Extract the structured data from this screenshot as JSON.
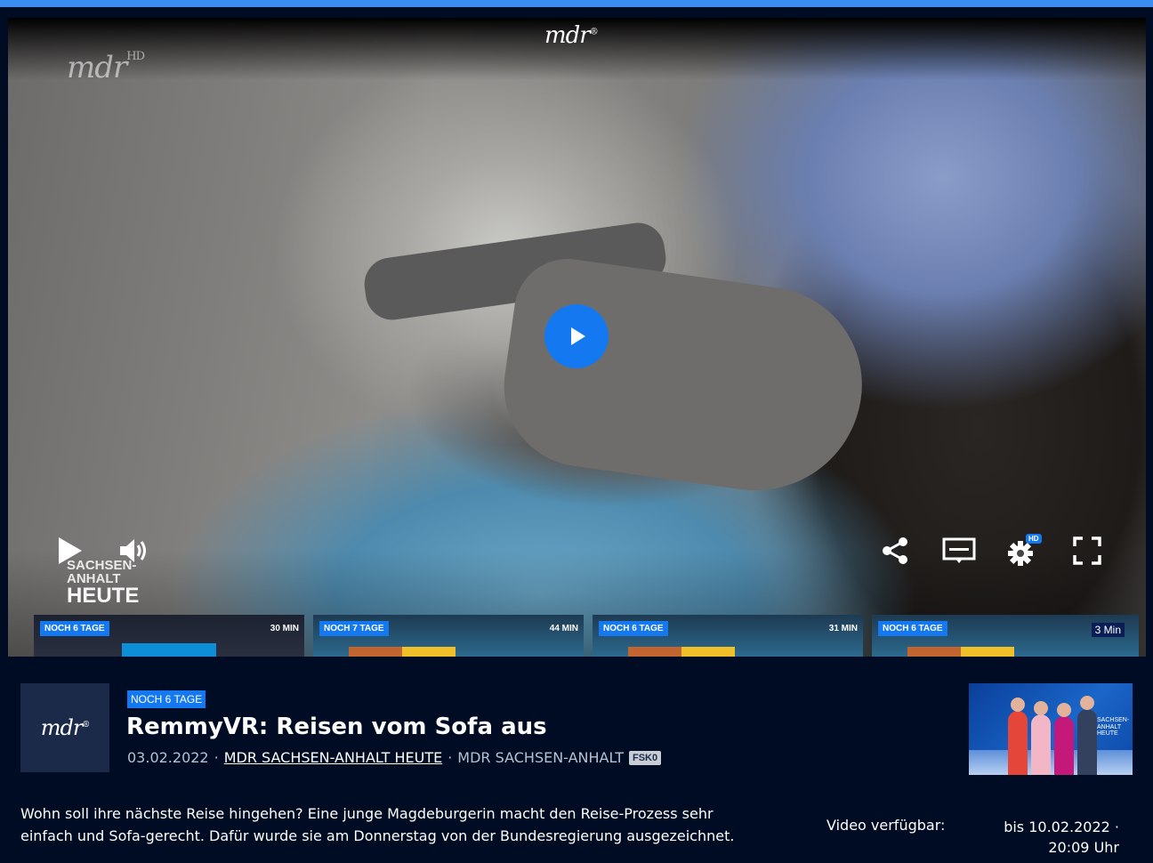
{
  "player": {
    "channel_logo": "mdr",
    "watermark_logo": "mdr",
    "watermark_hd": "HD",
    "show_logo": {
      "line1": "SACHSEN-",
      "line2": "ANHALT",
      "line3": "HEUTE"
    },
    "settings_hd_badge": "HD",
    "icons": [
      "play-icon",
      "volume-icon",
      "share-icon",
      "subtitles-icon",
      "settings-icon",
      "fullscreen-icon"
    ]
  },
  "thumbnails": [
    {
      "badge": "NOCH 6 TAGE",
      "duration": "30 MIN"
    },
    {
      "badge": "NOCH 7 TAGE",
      "duration": "44 MIN"
    },
    {
      "badge": "NOCH 6 TAGE",
      "duration": "31 MIN"
    },
    {
      "badge": "NOCH 6 TAGE",
      "duration": "3 Min"
    }
  ],
  "info": {
    "channel_logo": "mdr",
    "badge": "NOCH 6 TAGE",
    "title": "RemmyVR: Reisen vom Sofa aus",
    "date": "03.02.2022",
    "separator": "·",
    "show_link": "MDR SACHSEN-ANHALT HEUTE",
    "broadcaster": "MDR SACHSEN-ANHALT",
    "fsk": "FSK0",
    "preview_label": "SACHSEN-ANHALT HEUTE",
    "description": "Wohn soll ihre nächste Reise hingehen? Eine junge Magdeburgerin macht den Reise-Prozess sehr einfach und Sofa-gerecht. Dafür wurde sie am Donnerstag von der Bundesregierung ausgezeichnet.",
    "availability_label": "Video verfügbar:",
    "availability_date": "bis 10.02.2022 ·",
    "availability_time": "20:09 Uhr"
  },
  "colors": {
    "accent": "#1479f0",
    "background": "#000b24",
    "top_bar": "#3a8ef0"
  }
}
